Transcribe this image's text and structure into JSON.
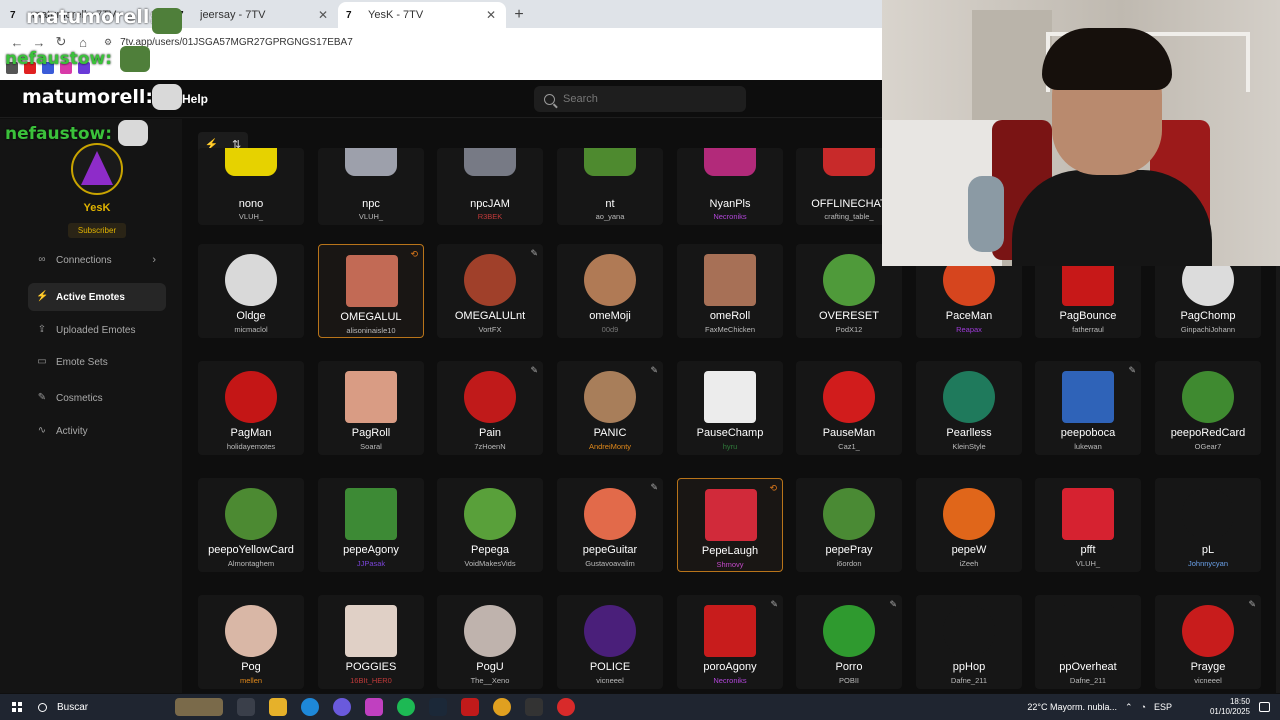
{
  "browser": {
    "tabs": [
      {
        "label": "matumorell - 7TV"
      },
      {
        "label": "jeersay - 7TV"
      },
      {
        "label": "YesK - 7TV"
      }
    ],
    "new_tab": "+",
    "url": "7tv.app/users/01JSGA57MGR27GPRGNGS17EBA7"
  },
  "overlay": {
    "name1": "matumorell:",
    "name2": "nefaustow:",
    "name3": "matumorell:",
    "name4": "nefaustow:"
  },
  "header": {
    "help": "Help",
    "search_placeholder": "Search"
  },
  "profile": {
    "username": "YesK",
    "badge": "Subscriber"
  },
  "sidebar": {
    "items": [
      {
        "label": "Connections",
        "icon": "link-icon"
      },
      {
        "label": "Active Emotes",
        "icon": "bolt-icon"
      },
      {
        "label": "Uploaded Emotes",
        "icon": "upload-icon"
      },
      {
        "label": "Emote Sets",
        "icon": "folder-icon"
      },
      {
        "label": "Cosmetics",
        "icon": "brush-icon"
      },
      {
        "label": "Activity",
        "icon": "activity-icon"
      }
    ]
  },
  "emotes": [
    {
      "name": "nono",
      "owner": "VLUH_",
      "owner_color": "#bbbbbb",
      "thumb": "#e6d200"
    },
    {
      "name": "npc",
      "owner": "VLUH_",
      "owner_color": "#bbbbbb",
      "thumb": "#9da0ab"
    },
    {
      "name": "npcJAM",
      "owner": "R3BEK",
      "owner_color": "#c03a3a",
      "thumb": "#777a85"
    },
    {
      "name": "nt",
      "owner": "ao_yana",
      "owner_color": "#bbbbbb",
      "thumb": "#4e8a2f"
    },
    {
      "name": "NyanPls",
      "owner": "Necroniks",
      "owner_color": "#b146d8",
      "thumb": "#b22a7a"
    },
    {
      "name": "OFFLINECHAT",
      "owner": "crafting_table_",
      "owner_color": "#bbbbbb",
      "thumb": "#c82a2a"
    },
    {
      "name": "Oldge",
      "owner": "micmaclol",
      "owner_color": "#bbbbbb",
      "thumb": "#d9d9d9"
    },
    {
      "name": "OMEGALUL",
      "owner": "alisoninaisle10",
      "owner_color": "#bbbbbb",
      "thumb": "#c26a55"
    },
    {
      "name": "OMEGALULnt",
      "owner": "VortFX",
      "owner_color": "#bbbbbb",
      "thumb": "#a0402a"
    },
    {
      "name": "omeMoji",
      "owner": "00d9",
      "owner_color": "#777777",
      "thumb": "#b07a55"
    },
    {
      "name": "omeRoll",
      "owner": "FaxMeChicken",
      "owner_color": "#bbbbbb",
      "thumb": "#a77056"
    },
    {
      "name": "OVERESET",
      "owner": "PodX12",
      "owner_color": "#bbbbbb",
      "thumb": "#4f9a3a"
    },
    {
      "name": "PaceMan",
      "owner": "Reapax",
      "owner_color": "#9d3ad8",
      "thumb": "#d6451e"
    },
    {
      "name": "PagBounce",
      "owner": "fatherraul",
      "owner_color": "#bbbbbb",
      "thumb": "#c71818"
    },
    {
      "name": "PagChomp",
      "owner": "GinpachiJohann",
      "owner_color": "#bbbbbb",
      "thumb": "#dcdcdc"
    },
    {
      "name": "PagMan",
      "owner": "holidayemotes",
      "owner_color": "#bbbbbb",
      "thumb": "#c41616"
    },
    {
      "name": "PagRoll",
      "owner": "Soaral",
      "owner_color": "#bbbbbb",
      "thumb": "#d99c84"
    },
    {
      "name": "Pain",
      "owner": "7zHoenN",
      "owner_color": "#bbbbbb",
      "thumb": "#c01a1a"
    },
    {
      "name": "PANIC",
      "owner": "AndreiMonty",
      "owner_color": "#e0881a",
      "thumb": "#a87e5a"
    },
    {
      "name": "PauseChamp",
      "owner": "hyru",
      "owner_color": "#2f7a3a",
      "thumb": "#ececec"
    },
    {
      "name": "PauseMan",
      "owner": "Caz1_",
      "owner_color": "#bbbbbb",
      "thumb": "#d11c1c"
    },
    {
      "name": "Pearlless",
      "owner": "KleinStyle",
      "owner_color": "#bbbbbb",
      "thumb": "#1f7a5c"
    },
    {
      "name": "peepoboca",
      "owner": "lukewan",
      "owner_color": "#bbbbbb",
      "thumb": "#2f63b8"
    },
    {
      "name": "peepoRedCard",
      "owner": "OGear7",
      "owner_color": "#bbbbbb",
      "thumb": "#3f8a30"
    },
    {
      "name": "peepoYellowCard",
      "owner": "Almontaghem",
      "owner_color": "#bbbbbb",
      "thumb": "#4c8a32"
    },
    {
      "name": "pepeAgony",
      "owner": "JJPasak",
      "owner_color": "#7a44d8",
      "thumb": "#3d8a35"
    },
    {
      "name": "Pepega",
      "owner": "VoidMakesVids",
      "owner_color": "#bbbbbb",
      "thumb": "#59a03a"
    },
    {
      "name": "pepeGuitar",
      "owner": "Gustavoavalim",
      "owner_color": "#bbbbbb",
      "thumb": "#e26a4a"
    },
    {
      "name": "PepeLaugh",
      "owner": "Shmovy",
      "owner_color": "#c248c8",
      "thumb": "#d12a3a"
    },
    {
      "name": "pepePray",
      "owner": "i6ordon",
      "owner_color": "#bbbbbb",
      "thumb": "#4a8a34"
    },
    {
      "name": "pepeW",
      "owner": "iZeeh",
      "owner_color": "#bbbbbb",
      "thumb": "#e0661a"
    },
    {
      "name": "pfft",
      "owner": "VLUH_",
      "owner_color": "#bbbbbb",
      "thumb": "#d62230"
    },
    {
      "name": "pL",
      "owner": "Johnnycyan",
      "owner_color": "#6aa0e8",
      "thumb": "#161616"
    },
    {
      "name": "Pog",
      "owner": "mellen",
      "owner_color": "#e0881a",
      "thumb": "#d9b7a6"
    },
    {
      "name": "POGGIES",
      "owner": "16BIt_HER0",
      "owner_color": "#c03a3a",
      "thumb": "#e0d0c6"
    },
    {
      "name": "PogU",
      "owner": "The__Xeno",
      "owner_color": "#bbbbbb",
      "thumb": "#bfb3ad"
    },
    {
      "name": "POLICE",
      "owner": "vicneeel",
      "owner_color": "#bbbbbb",
      "thumb": "#4a1f7a"
    },
    {
      "name": "poroAgony",
      "owner": "Necroniks",
      "owner_color": "#b146d8",
      "thumb": "#c81c1c"
    },
    {
      "name": "Porro",
      "owner": "POBII",
      "owner_color": "#bbbbbb",
      "thumb": "#2f9a2f"
    },
    {
      "name": "ppHop",
      "owner": "Dafne_211",
      "owner_color": "#bbbbbb",
      "thumb": "#161616"
    },
    {
      "name": "ppOverheat",
      "owner": "Dafne_211",
      "owner_color": "#bbbbbb",
      "thumb": "#161616"
    },
    {
      "name": "Prayge",
      "owner": "vicneeel",
      "owner_color": "#bbbbbb",
      "thumb": "#c81c1c"
    }
  ],
  "taskbar": {
    "search": "Buscar",
    "weather": "22°C  Mayorm. nubla...",
    "lang": "ESP",
    "time": "18:50",
    "date": "01/10/2025"
  }
}
